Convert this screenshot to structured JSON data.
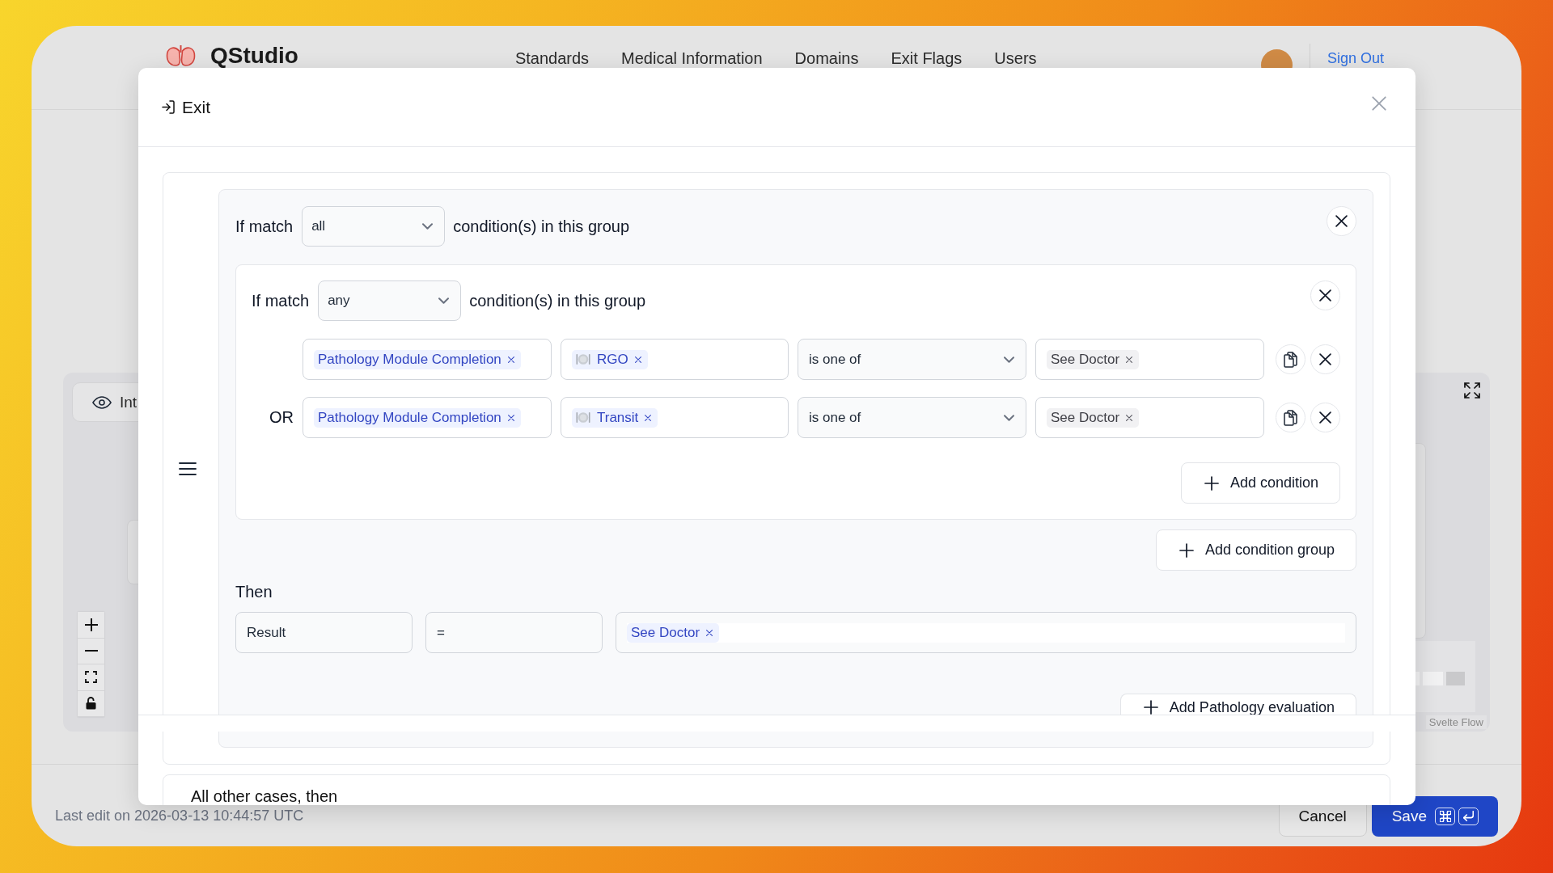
{
  "app": {
    "name": "QStudio",
    "nav": [
      "Standards",
      "Medical Information",
      "Domains",
      "Exit Flags",
      "Users"
    ],
    "sign_out": "Sign Out"
  },
  "canvas": {
    "view_button": "Int",
    "attribution": "Svelte Flow"
  },
  "footer": {
    "last_edit": "Last edit on 2026-03-13 10:44:57 UTC",
    "cancel": "Cancel",
    "save": "Save"
  },
  "dialog": {
    "title": "Exit",
    "rule": {
      "match_label": "If match",
      "match": "all",
      "suffix": "condition(s) in this group",
      "groups": [
        {
          "match_label": "If match",
          "match": "any",
          "suffix": "condition(s) in this group",
          "conditions": [
            {
              "field": [
                "Pathology Module Completion"
              ],
              "item": [
                "RGO"
              ],
              "operator": "is one of",
              "values": [
                "See Doctor"
              ]
            },
            {
              "connector": "OR",
              "field": [
                "Pathology Module Completion"
              ],
              "item": [
                "Transit"
              ],
              "operator": "is one of",
              "values": [
                "See Doctor"
              ]
            }
          ],
          "add_condition": "Add condition"
        }
      ],
      "add_group": "Add condition group",
      "then_label": "Then",
      "then": {
        "target": "Result",
        "operator": "=",
        "values": [
          "See Doctor"
        ]
      },
      "add_evaluation": "Add Pathology evaluation"
    },
    "fallback": "All other cases, then"
  }
}
